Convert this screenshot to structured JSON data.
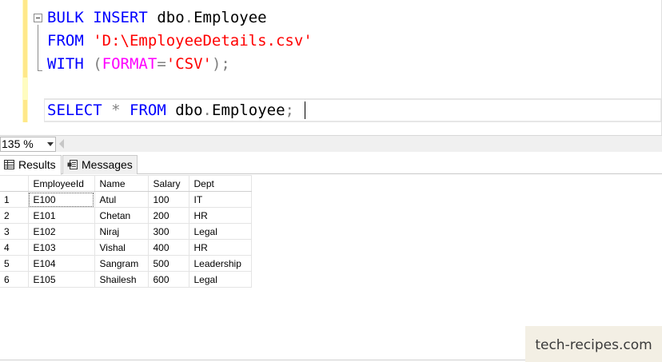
{
  "editor": {
    "line1": {
      "kw1": "BULK",
      "kw2": "INSERT",
      "obj1": "dbo",
      "dot": ".",
      "obj2": "Employee"
    },
    "line2": {
      "kw": "FROM",
      "str": "'D:\\EmployeeDetails.csv'"
    },
    "line3": {
      "kw": "WITH",
      "open": "(",
      "fn": "FORMAT",
      "eq": "=",
      "str": "'CSV'",
      "close": ")",
      "semi": ";"
    },
    "line5": {
      "kw1": "SELECT",
      "star": "*",
      "kw2": "FROM",
      "obj1": "dbo",
      "dot": ".",
      "obj2": "Employee",
      "semi": ";"
    }
  },
  "zoom": {
    "value": "135 %"
  },
  "tabs": {
    "results": "Results",
    "messages": "Messages"
  },
  "results": {
    "columns": [
      "EmployeeId",
      "Name",
      "Salary",
      "Dept"
    ],
    "rows": [
      {
        "n": "1",
        "id": "E100",
        "name": "Atul",
        "salary": "100",
        "dept": "IT"
      },
      {
        "n": "2",
        "id": "E101",
        "name": "Chetan",
        "salary": "200",
        "dept": "HR"
      },
      {
        "n": "3",
        "id": "E102",
        "name": "Niraj",
        "salary": "300",
        "dept": "Legal"
      },
      {
        "n": "4",
        "id": "E103",
        "name": "Vishal",
        "salary": "400",
        "dept": "HR"
      },
      {
        "n": "5",
        "id": "E104",
        "name": "Sangram",
        "salary": "500",
        "dept": "Leadership"
      },
      {
        "n": "6",
        "id": "E105",
        "name": "Shailesh",
        "salary": "600",
        "dept": "Legal"
      }
    ]
  },
  "watermark": {
    "text": "tech-recipes.com"
  },
  "icons": {
    "results_tab": "grid-icon",
    "messages_tab": "messages-icon",
    "zoom": "chevron-down-icon"
  }
}
